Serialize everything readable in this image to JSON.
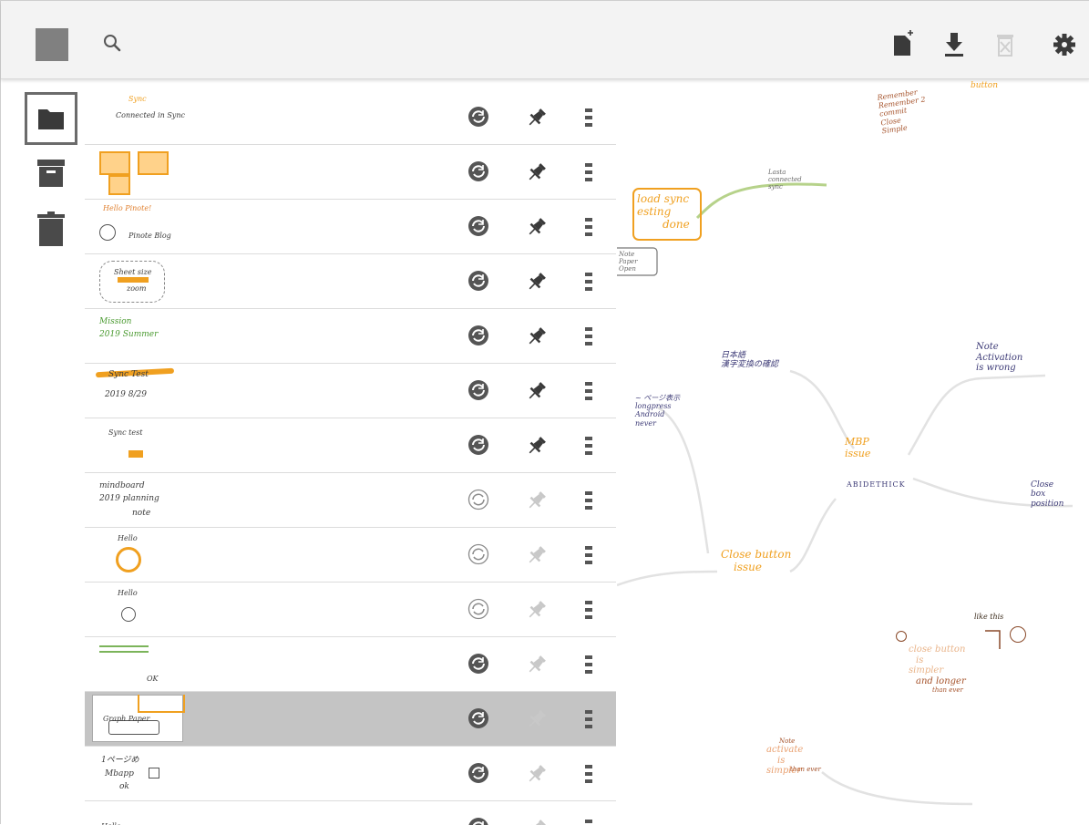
{
  "toolbar": {
    "icons": [
      "app-icon",
      "search-icon",
      "new-note-icon",
      "download-icon",
      "delete-icon",
      "settings-icon"
    ]
  },
  "sidebar": {
    "items": [
      {
        "name": "folder-icon",
        "active": true
      },
      {
        "name": "archive-icon",
        "active": false
      },
      {
        "name": "trash-icon",
        "active": false
      }
    ]
  },
  "notes": [
    {
      "thumb": [
        "Sync",
        "Connected in Sync"
      ],
      "synced": true,
      "pinned": true,
      "selected": false
    },
    {
      "thumb": [],
      "synced": true,
      "pinned": true,
      "selected": false
    },
    {
      "thumb": [
        "Hello Pinote!",
        "Pinote Blog"
      ],
      "synced": true,
      "pinned": true,
      "selected": false
    },
    {
      "thumb": [
        "Sheet size",
        "zoom"
      ],
      "synced": true,
      "pinned": true,
      "selected": false
    },
    {
      "thumb": [
        "Mission",
        "2019 Summer"
      ],
      "synced": true,
      "pinned": true,
      "selected": false
    },
    {
      "thumb": [
        "Sync Test",
        "2019 8/29"
      ],
      "synced": true,
      "pinned": true,
      "selected": false
    },
    {
      "thumb": [
        "Sync test"
      ],
      "synced": true,
      "pinned": true,
      "selected": false
    },
    {
      "thumb": [
        "mindboard",
        "2019 planning",
        "note"
      ],
      "synced": false,
      "pinned": false,
      "selected": false
    },
    {
      "thumb": [
        "Hello"
      ],
      "synced": false,
      "pinned": false,
      "selected": false
    },
    {
      "thumb": [
        "Hello"
      ],
      "synced": false,
      "pinned": false,
      "selected": false
    },
    {
      "thumb": [
        "OK"
      ],
      "synced": true,
      "pinned": false,
      "selected": false
    },
    {
      "thumb": [
        "Graph Paper"
      ],
      "synced": true,
      "pinned": false,
      "selected": true
    },
    {
      "thumb": [
        "1ページめ",
        "Mbapp",
        "ok"
      ],
      "synced": true,
      "pinned": false,
      "selected": false
    },
    {
      "thumb": [
        "Hello"
      ],
      "synced": true,
      "pinned": false,
      "selected": false
    }
  ],
  "canvas": {
    "brown_notes": [
      "Remember",
      "Remember 2",
      "button",
      "commit",
      "Close",
      "Simple"
    ],
    "load_sync": [
      "load sync",
      "esting",
      "done"
    ],
    "green_branch": [
      "Lasta",
      "connected",
      "sync"
    ],
    "side_note": [
      "Note",
      "Paper",
      "Open"
    ],
    "navy_top": [
      "日本語",
      "漢字変換の確認"
    ],
    "navy_left": [
      "~ ページ表示",
      "longpress",
      "Android",
      "never"
    ],
    "center_orange": [
      "MBP",
      "issue"
    ],
    "center_navy": "ABIDETHICK",
    "right_top": [
      "Note",
      "Activation",
      "is wrong"
    ],
    "right_mid": [
      "Close",
      "box",
      "position"
    ],
    "closebutton": [
      "Close button",
      "issue"
    ],
    "bottom_right_brown": [
      "like this",
      "close button",
      "is",
      "simpler",
      "and longer",
      "than ever"
    ],
    "bottom_note": [
      "Note",
      "activate",
      "is",
      "simpler",
      "than ever"
    ],
    "colors": {
      "brown": "#a5522a",
      "orange": "#f0a020",
      "navy": "#3c3a76",
      "green": "#b6d28a",
      "branch": "#e0e0e0"
    }
  }
}
